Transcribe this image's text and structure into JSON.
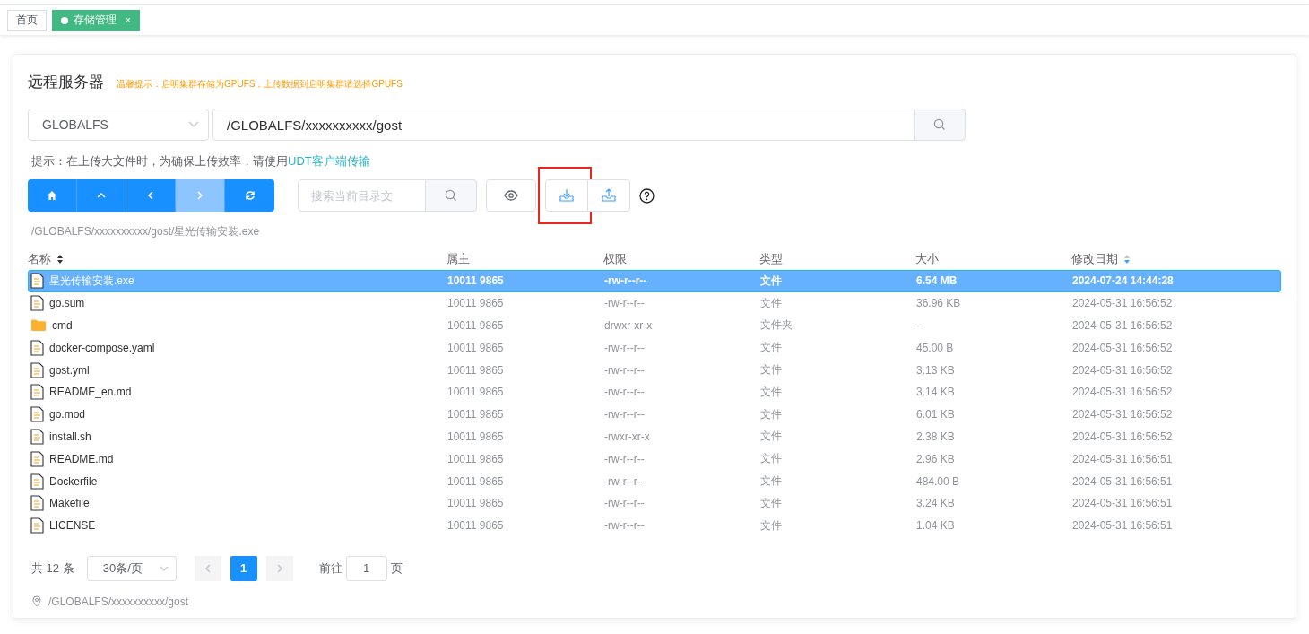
{
  "tabs": [
    {
      "label": "首页",
      "selected": false
    },
    {
      "label": "存储管理",
      "selected": true,
      "close": "×"
    }
  ],
  "panel": {
    "title": "远程服务器",
    "warning": "温馨提示：启明集群存储为GPUFS，上传数据到启明集群请选择GPUFS"
  },
  "location": {
    "storage": "GLOBALFS",
    "path": "/GLOBALFS/xxxxxxxxxx/gost"
  },
  "hint": {
    "text": "提示：在上传大文件时，为确保上传效率，请使用",
    "link": "UDT客户端传输"
  },
  "nav_buttons": [
    {
      "kind": "home",
      "disabled": false
    },
    {
      "kind": "up",
      "disabled": false
    },
    {
      "kind": "back",
      "disabled": false
    },
    {
      "kind": "forward",
      "disabled": true
    },
    {
      "kind": "refresh",
      "disabled": false
    }
  ],
  "filter": {
    "placeholder": "搜索当前目录文"
  },
  "action_buttons": [
    {
      "kind": "preview",
      "highlighted": false
    },
    {
      "kind": "download",
      "highlighted": true
    },
    {
      "kind": "upload",
      "highlighted": false
    }
  ],
  "selected_path": "/GLOBALFS/xxxxxxxxxx/gost/星光传输安装.exe",
  "table": {
    "columns": [
      {
        "label": "名称",
        "sorted": false
      },
      {
        "label": "属主"
      },
      {
        "label": "权限"
      },
      {
        "label": "类型"
      },
      {
        "label": "大小"
      },
      {
        "label": "修改日期",
        "sorted": true
      }
    ],
    "rows": [
      {
        "kind": "file",
        "selected": true,
        "name": "星光传输安装.exe",
        "owner": "10011 9865",
        "perm": "-rw-r--r--",
        "type": "文件",
        "size": "6.54 MB",
        "date": "2024-07-24 14:44:28"
      },
      {
        "kind": "file",
        "selected": false,
        "name": "go.sum",
        "owner": "10011 9865",
        "perm": "-rw-r--r--",
        "type": "文件",
        "size": "36.96 KB",
        "date": "2024-05-31 16:56:52"
      },
      {
        "kind": "folder",
        "selected": false,
        "name": "cmd",
        "owner": "10011 9865",
        "perm": "drwxr-xr-x",
        "type": "文件夹",
        "size": "-",
        "date": "2024-05-31 16:56:52"
      },
      {
        "kind": "file",
        "selected": false,
        "name": "docker-compose.yaml",
        "owner": "10011 9865",
        "perm": "-rw-r--r--",
        "type": "文件",
        "size": "45.00 B",
        "date": "2024-05-31 16:56:52"
      },
      {
        "kind": "file",
        "selected": false,
        "name": "gost.yml",
        "owner": "10011 9865",
        "perm": "-rw-r--r--",
        "type": "文件",
        "size": "3.13 KB",
        "date": "2024-05-31 16:56:52"
      },
      {
        "kind": "file",
        "selected": false,
        "name": "README_en.md",
        "owner": "10011 9865",
        "perm": "-rw-r--r--",
        "type": "文件",
        "size": "3.14 KB",
        "date": "2024-05-31 16:56:52"
      },
      {
        "kind": "file",
        "selected": false,
        "name": "go.mod",
        "owner": "10011 9865",
        "perm": "-rw-r--r--",
        "type": "文件",
        "size": "6.01 KB",
        "date": "2024-05-31 16:56:52"
      },
      {
        "kind": "file",
        "selected": false,
        "name": "install.sh",
        "owner": "10011 9865",
        "perm": "-rwxr-xr-x",
        "type": "文件",
        "size": "2.38 KB",
        "date": "2024-05-31 16:56:52"
      },
      {
        "kind": "file",
        "selected": false,
        "name": "README.md",
        "owner": "10011 9865",
        "perm": "-rw-r--r--",
        "type": "文件",
        "size": "2.96 KB",
        "date": "2024-05-31 16:56:51"
      },
      {
        "kind": "file",
        "selected": false,
        "name": "Dockerfile",
        "owner": "10011 9865",
        "perm": "-rw-r--r--",
        "type": "文件",
        "size": "484.00 B",
        "date": "2024-05-31 16:56:51"
      },
      {
        "kind": "file",
        "selected": false,
        "name": "Makefile",
        "owner": "10011 9865",
        "perm": "-rw-r--r--",
        "type": "文件",
        "size": "3.24 KB",
        "date": "2024-05-31 16:56:51"
      },
      {
        "kind": "file",
        "selected": false,
        "name": "LICENSE",
        "owner": "10011 9865",
        "perm": "-rw-r--r--",
        "type": "文件",
        "size": "1.04 KB",
        "date": "2024-05-31 16:56:51"
      }
    ]
  },
  "pagination": {
    "total": "共 12 条",
    "page_size": "30条/页",
    "pages": [
      {
        "label": "1",
        "selected": true
      }
    ],
    "goto_label": "前往",
    "goto_value": "1",
    "goto_suffix": "页"
  },
  "footer_path": "/GLOBALFS/xxxxxxxxxx/gost"
}
